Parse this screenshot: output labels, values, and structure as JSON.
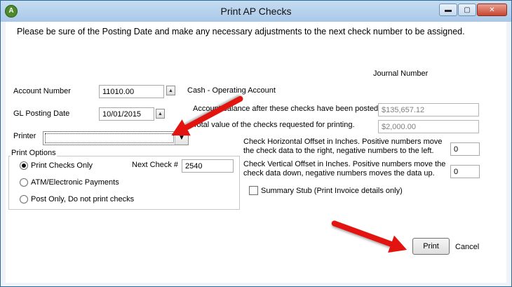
{
  "window": {
    "title": "Print AP Checks",
    "app_icon": "A",
    "minimize": "▬",
    "maximize": "▢",
    "close": "✕"
  },
  "instructions": "Please be sure of the Posting Date and make any necessary adjustments to the next check number to be assigned.",
  "journal_number_label": "Journal Number",
  "account": {
    "label": "Account Number",
    "value": "11010.00",
    "name": "Cash - Operating Account"
  },
  "gl_posting": {
    "label": "GL Posting Date",
    "value": "10/01/2015"
  },
  "printer": {
    "label": "Printer",
    "value": ""
  },
  "balance": {
    "label": "Account balance after these checks have been posted",
    "value": "$135,657.12"
  },
  "total": {
    "label": "Total value of the checks requested for printing.",
    "value": "$2,000.00"
  },
  "print_options": {
    "legend": "Print Options",
    "options": [
      "Print Checks Only",
      "ATM/Electronic  Payments",
      "Post Only, Do not print checks"
    ],
    "selected": 0,
    "next_check_label": "Next Check #",
    "next_check_value": "2540"
  },
  "horizontal_offset": {
    "line1": "Check Horizontal Offset in Inches.  Positive numbers move",
    "line2": "the check data to the right, negative numbers to the left.",
    "value": "0"
  },
  "vertical_offset": {
    "line1": "Check Vertical Offset in Inches.  Positive numbers move the",
    "line2": "check data down, negative numbers moves the data up.",
    "value": "0"
  },
  "summary_stub": {
    "label": "Summary Stub (Print Invoice details only)",
    "checked": false
  },
  "buttons": {
    "print": "Print",
    "cancel": "Cancel"
  },
  "colors": {
    "arrow": "#e3140f",
    "titlebar": "#b9d3ee"
  }
}
